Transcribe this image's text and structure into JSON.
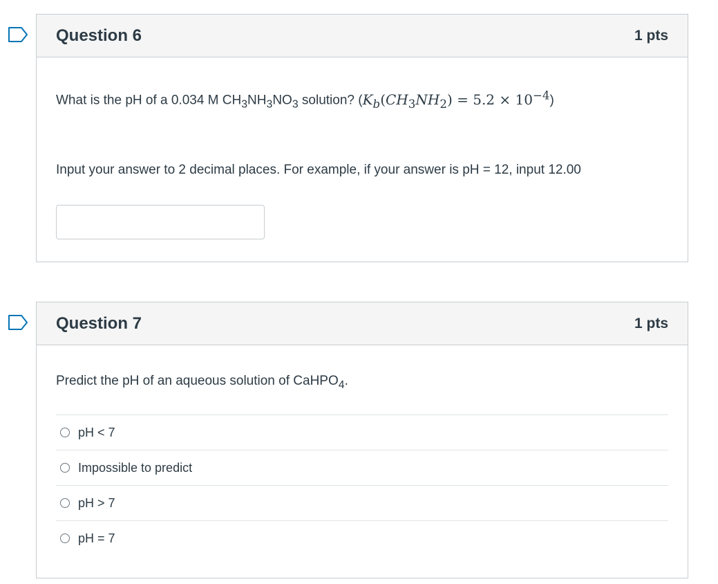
{
  "questions": [
    {
      "title": "Question 6",
      "points": "1 pts",
      "text_prefix": "What is the pH of a 0.034 M CH",
      "sub_3a": "3",
      "text_nh": "NH",
      "sub_3b": "3",
      "text_no": "NO",
      "sub_3c": "3",
      "text_solution": " solution? (",
      "math_k": "K",
      "math_b": "b",
      "math_open": "(",
      "math_ch": "CH",
      "math_sub3": "3",
      "math_nh": "NH",
      "math_sub2": "2",
      "math_close": ") = 5.2 × 10",
      "math_exp": "−4",
      "text_end": ")",
      "instruction": "Input your answer to 2 decimal places. For example, if your answer is pH = 12, input 12.00",
      "input_value": "",
      "input_placeholder": ""
    },
    {
      "title": "Question 7",
      "points": "1 pts",
      "text_prefix": "Predict the pH of an aqueous solution of CaHPO",
      "sub_4": "4",
      "text_end": ".",
      "options": [
        "pH < 7",
        "Impossible to predict",
        "pH > 7",
        "pH = 7"
      ]
    }
  ],
  "colors": {
    "flag": "#0374b5",
    "border": "#c7cdd1",
    "header_bg": "#f5f5f5",
    "text": "#2d3b45"
  }
}
